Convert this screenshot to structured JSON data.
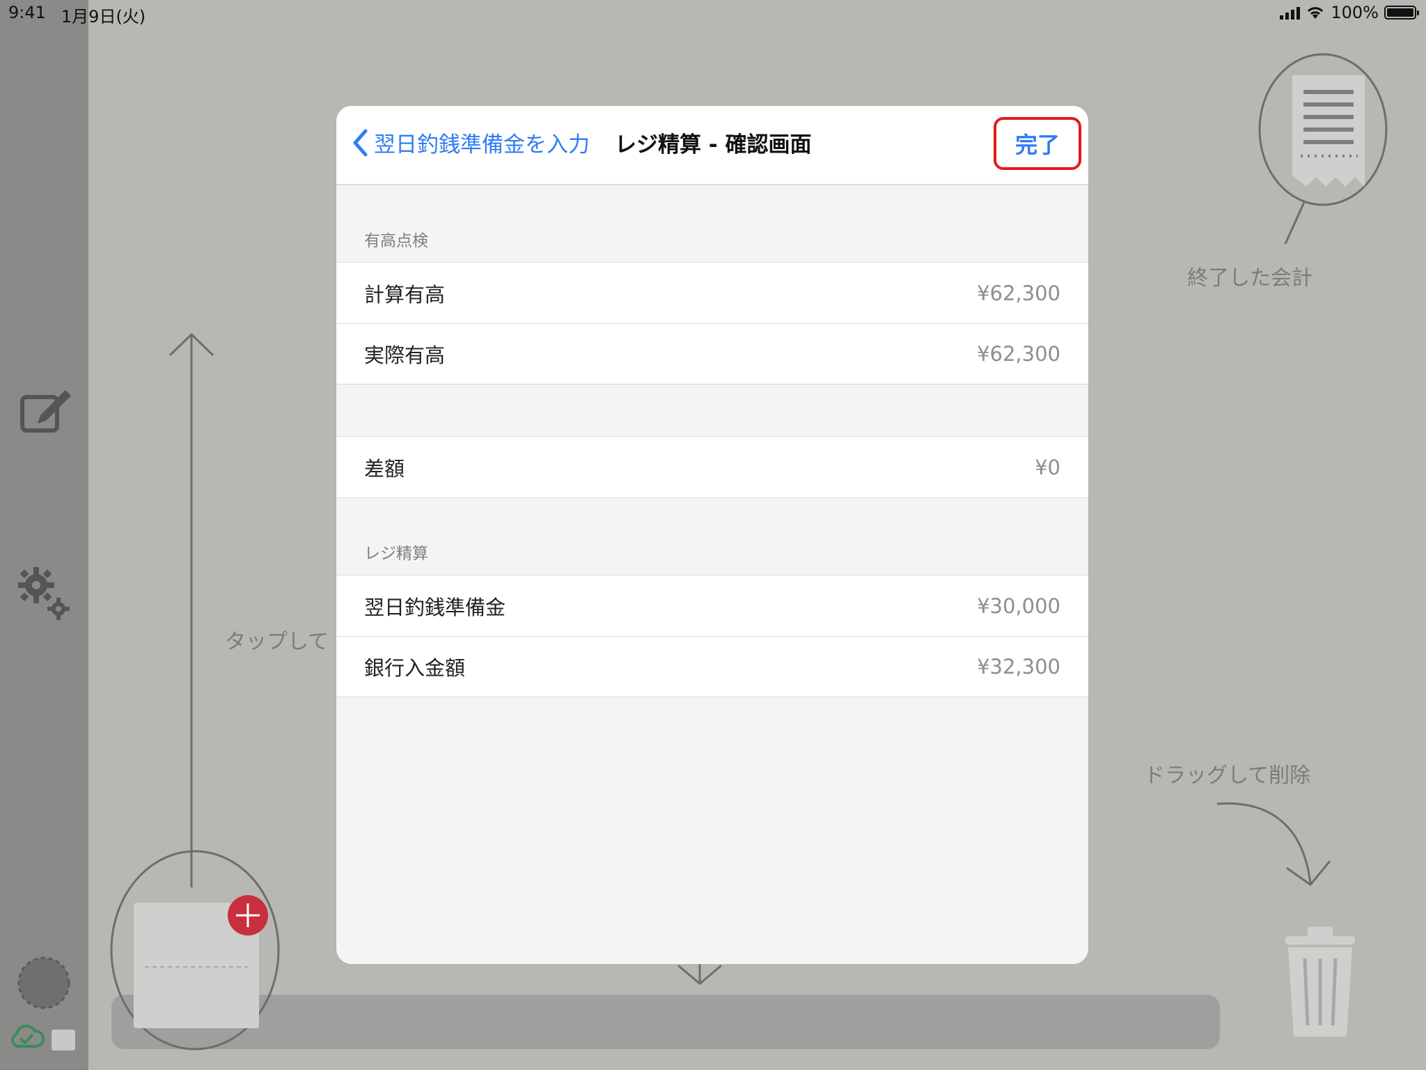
{
  "status_bar": {
    "time": "9:41",
    "date": "1月9日(火)",
    "battery": "100%"
  },
  "background": {
    "finished_label": "終了した会計",
    "drag_delete_label": "ドラッグして削除",
    "tap_hint": "タップして"
  },
  "modal": {
    "back_label": "翌日釣銭準備金を入力",
    "title": "レジ精算 - 確認画面",
    "done_label": "完了",
    "sections": [
      {
        "header": "有高点検",
        "rows": [
          {
            "label": "計算有高",
            "value": "¥62,300"
          },
          {
            "label": "実際有高",
            "value": "¥62,300"
          }
        ]
      },
      {
        "header": "",
        "rows": [
          {
            "label": "差額",
            "value": "¥0"
          }
        ]
      },
      {
        "header": "レジ精算",
        "rows": [
          {
            "label": "翌日釣銭準備金",
            "value": "¥30,000"
          },
          {
            "label": "銀行入金額",
            "value": "¥32,300"
          }
        ]
      }
    ]
  },
  "colors": {
    "accent": "#2f7cf6",
    "highlight_border": "#e41a1a",
    "add_badge": "#c8303f"
  }
}
